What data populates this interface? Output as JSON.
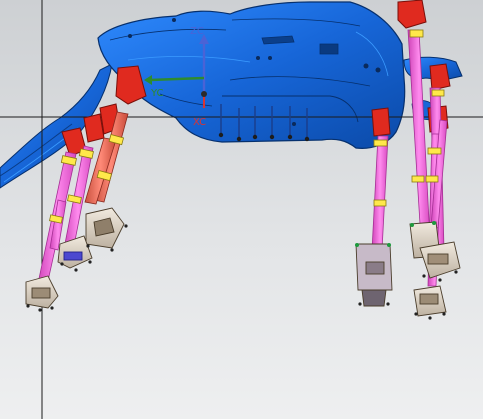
{
  "viewport": {
    "axes": {
      "zc": {
        "label": "ZC",
        "color": "#4a63d6"
      },
      "yc": {
        "label": "YC",
        "color": "#2e8b2e"
      },
      "xc": {
        "label": "XC",
        "color": "#d83434"
      }
    },
    "model": {
      "part_color": "#1565d8",
      "part_edge_color": "#06306e",
      "arm_color": "#ff77e6",
      "cylinder_color": "#f07766",
      "clamp_color": "#e02a1f",
      "collar_color": "#ffe84a",
      "crosshair_color": "#1b1b1b"
    }
  }
}
